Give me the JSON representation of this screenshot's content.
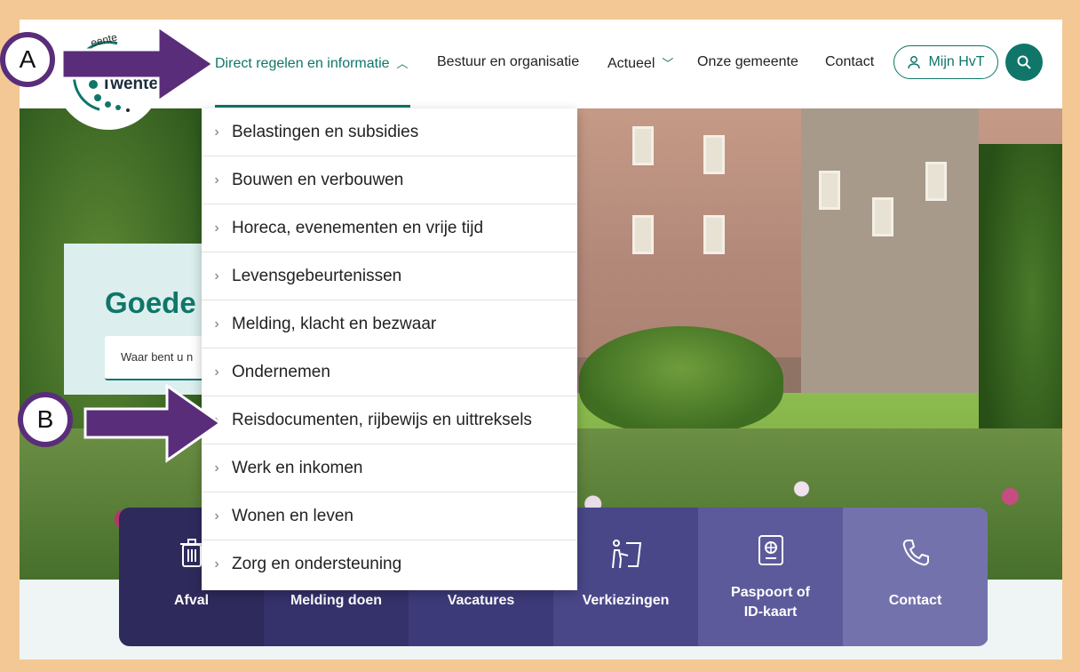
{
  "header": {
    "logo_top": "eente",
    "logo_text": "Twente",
    "nav": [
      {
        "label": "Direct regelen en informatie",
        "chevron": "up"
      },
      {
        "label": "Bestuur en organisatie"
      },
      {
        "label": "Actueel",
        "chevron": "down"
      },
      {
        "label": "Onze gemeente"
      },
      {
        "label": "Contact"
      }
    ],
    "mijn_label": "Mijn HvT"
  },
  "welcome": {
    "title": "Goede",
    "search_placeholder": "Waar bent u n"
  },
  "dropdown": {
    "items": [
      "Belastingen en subsidies",
      "Bouwen en verbouwen",
      "Horeca, evenementen en vrije tijd",
      "Levensgebeurtenissen",
      "Melding, klacht en bezwaar",
      "Ondernemen",
      "Reisdocumenten, rijbewijs en uittreksels",
      "Werk en inkomen",
      "Wonen en leven",
      "Zorg en ondersteuning"
    ]
  },
  "tiles": [
    {
      "label": "Afval",
      "icon": "trash-icon",
      "color": "#2e2a5c"
    },
    {
      "label": "Melding doen",
      "icon": "megaphone-icon",
      "color": "#35316b"
    },
    {
      "label": "Vacatures",
      "icon": "briefcase-icon",
      "color": "#3d3a7a"
    },
    {
      "label": "Verkiezingen",
      "icon": "ballot-icon",
      "color": "#4a4789"
    },
    {
      "label_line1": "Paspoort of",
      "label_line2": "ID-kaart",
      "icon": "passport-icon",
      "color": "#5c5a9a"
    },
    {
      "label": "Contact",
      "icon": "phone-icon",
      "color": "#7472ad"
    }
  ],
  "annotations": {
    "a": "A",
    "b": "B"
  },
  "colors": {
    "frame": "#f3c895",
    "brand_teal": "#0f7669",
    "annotation_purple": "#5a2d7a"
  }
}
